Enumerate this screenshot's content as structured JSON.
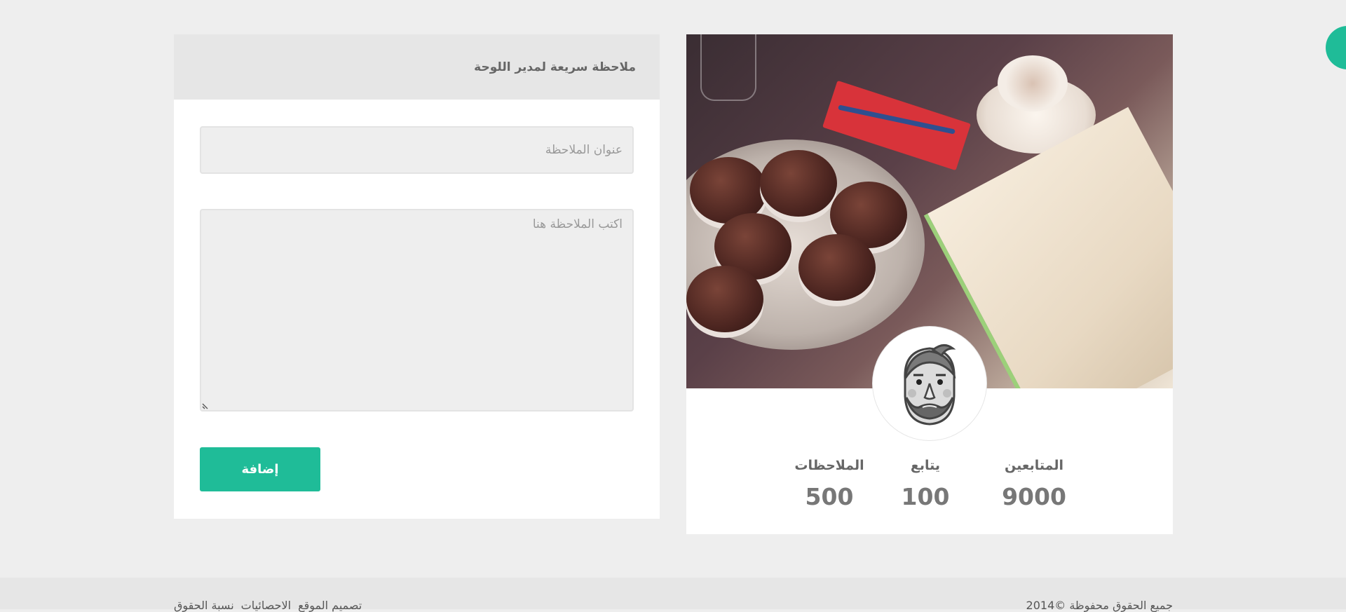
{
  "note": {
    "header_title": "ملاحظة سريعة لمدير اللوحة",
    "title_placeholder": "عنوان الملاحظة",
    "body_placeholder": "اكتب الملاحظة هنا",
    "add_button": "إضافة"
  },
  "profile": {
    "stats": [
      {
        "label": "المتابعين",
        "value": "9000"
      },
      {
        "label": "يتابع",
        "value": "100"
      },
      {
        "label": "الملاحظات",
        "value": "500"
      }
    ]
  },
  "footer": {
    "links": [
      "تصميم الموقع",
      "الاحصائيات",
      "نسبة الحقوق"
    ],
    "copyright": "جميع الحقوق محفوظة ©2014"
  },
  "colors": {
    "accent": "#1fbc98",
    "page_bg": "#eeeeee",
    "card_header_bg": "#e6e6e6"
  }
}
